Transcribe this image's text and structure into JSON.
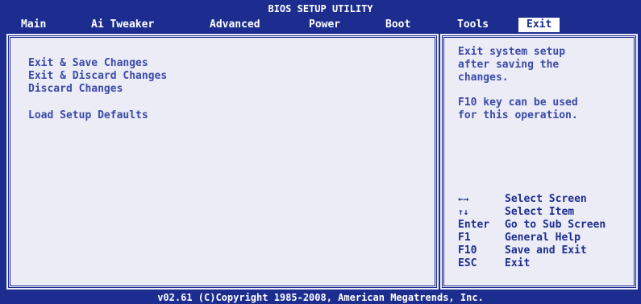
{
  "header": {
    "title": "BIOS SETUP UTILITY"
  },
  "tabs": [
    {
      "label": "Main"
    },
    {
      "label": "Ai Tweaker"
    },
    {
      "label": "Advanced"
    },
    {
      "label": "Power"
    },
    {
      "label": "Boot"
    },
    {
      "label": "Tools"
    },
    {
      "label": "Exit"
    }
  ],
  "menu": {
    "items": [
      {
        "label": "Exit & Save Changes"
      },
      {
        "label": "Exit & Discard Changes"
      },
      {
        "label": "Discard Changes"
      },
      {
        "label": "Load Setup Defaults"
      }
    ]
  },
  "help": {
    "description": "Exit system setup\nafter saving the\nchanges.",
    "note": "F10 key can be used\nfor this operation."
  },
  "keys": [
    {
      "key_icon": "left-right-arrows-icon",
      "desc": "Select Screen"
    },
    {
      "key_icon": "up-down-arrows-icon",
      "desc": "Select Item"
    },
    {
      "key": "Enter",
      "desc": "Go to Sub Screen"
    },
    {
      "key": "F1",
      "desc": "General Help"
    },
    {
      "key": "F10",
      "desc": "Save and Exit"
    },
    {
      "key": "ESC",
      "desc": "Exit"
    }
  ],
  "footer": {
    "copyright": "v02.61 (C)Copyright 1985-2008, American Megatrends, Inc."
  },
  "colors": {
    "primary": "#1c2d8f",
    "panel": "#ececf6",
    "text": "#3a4aa8"
  }
}
